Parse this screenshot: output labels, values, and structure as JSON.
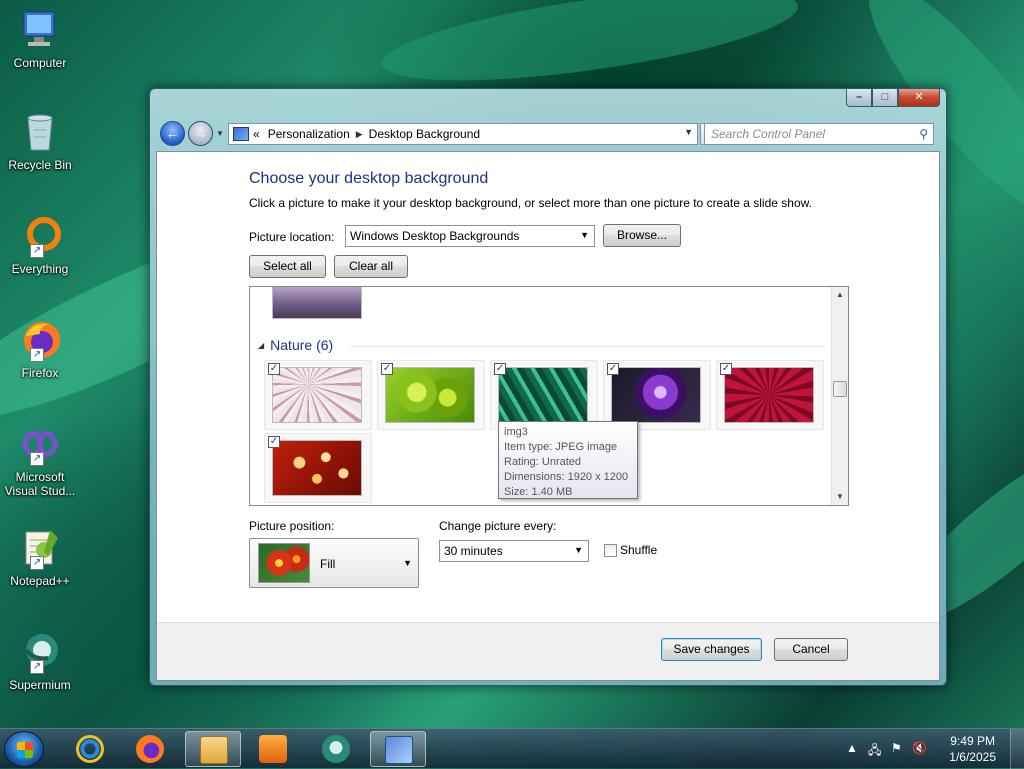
{
  "desktop": {
    "icons": [
      {
        "label": "Computer",
        "icon": "computer-icon"
      },
      {
        "label": "Recycle Bin",
        "icon": "recycle-bin-icon"
      },
      {
        "label": "Everything",
        "icon": "everything-icon"
      },
      {
        "label": "Firefox",
        "icon": "firefox-icon"
      },
      {
        "label": "Microsoft Visual Stud...",
        "icon": "visual-studio-icon"
      },
      {
        "label": "Notepad++",
        "icon": "notepadpp-icon"
      },
      {
        "label": "Supermium",
        "icon": "supermium-icon"
      }
    ]
  },
  "window": {
    "address": {
      "prefix": "«",
      "crumbs": [
        "Personalization",
        "Desktop Background"
      ]
    },
    "search_placeholder": "Search Control Panel",
    "heading": "Choose your desktop background",
    "description": "Click a picture to make it your desktop background, or select more than one picture to create a slide show.",
    "picture_location_label": "Picture location:",
    "picture_location_value": "Windows Desktop Backgrounds",
    "browse_label": "Browse...",
    "select_all_label": "Select all",
    "clear_all_label": "Clear all",
    "gallery": {
      "group_name": "Nature (6)",
      "items": [
        {
          "name": "img1",
          "checked": true
        },
        {
          "name": "img2",
          "checked": true
        },
        {
          "name": "img3",
          "checked": true
        },
        {
          "name": "img4",
          "checked": true
        },
        {
          "name": "img5",
          "checked": true
        },
        {
          "name": "img6",
          "checked": true
        }
      ],
      "tooltip": {
        "name": "img3",
        "type": "Item type: JPEG image",
        "rating": "Rating: Unrated",
        "dimensions": "Dimensions: 1920 x 1200",
        "size": "Size: 1.40 MB"
      }
    },
    "picture_position_label": "Picture position:",
    "picture_position_value": "Fill",
    "change_every_label": "Change picture every:",
    "change_every_value": "30 minutes",
    "shuffle_label": "Shuffle",
    "shuffle_checked": false,
    "save_label": "Save changes",
    "cancel_label": "Cancel"
  },
  "taskbar": {
    "time": "9:49 PM",
    "date": "1/6/2025",
    "items": [
      "ie-icon",
      "firefox-icon",
      "explorer-icon",
      "media-player-icon",
      "supermium-icon",
      "control-panel-icon"
    ]
  },
  "colors": {
    "heading_blue": "#1e3287",
    "taskbar": "#2a4a5e"
  }
}
